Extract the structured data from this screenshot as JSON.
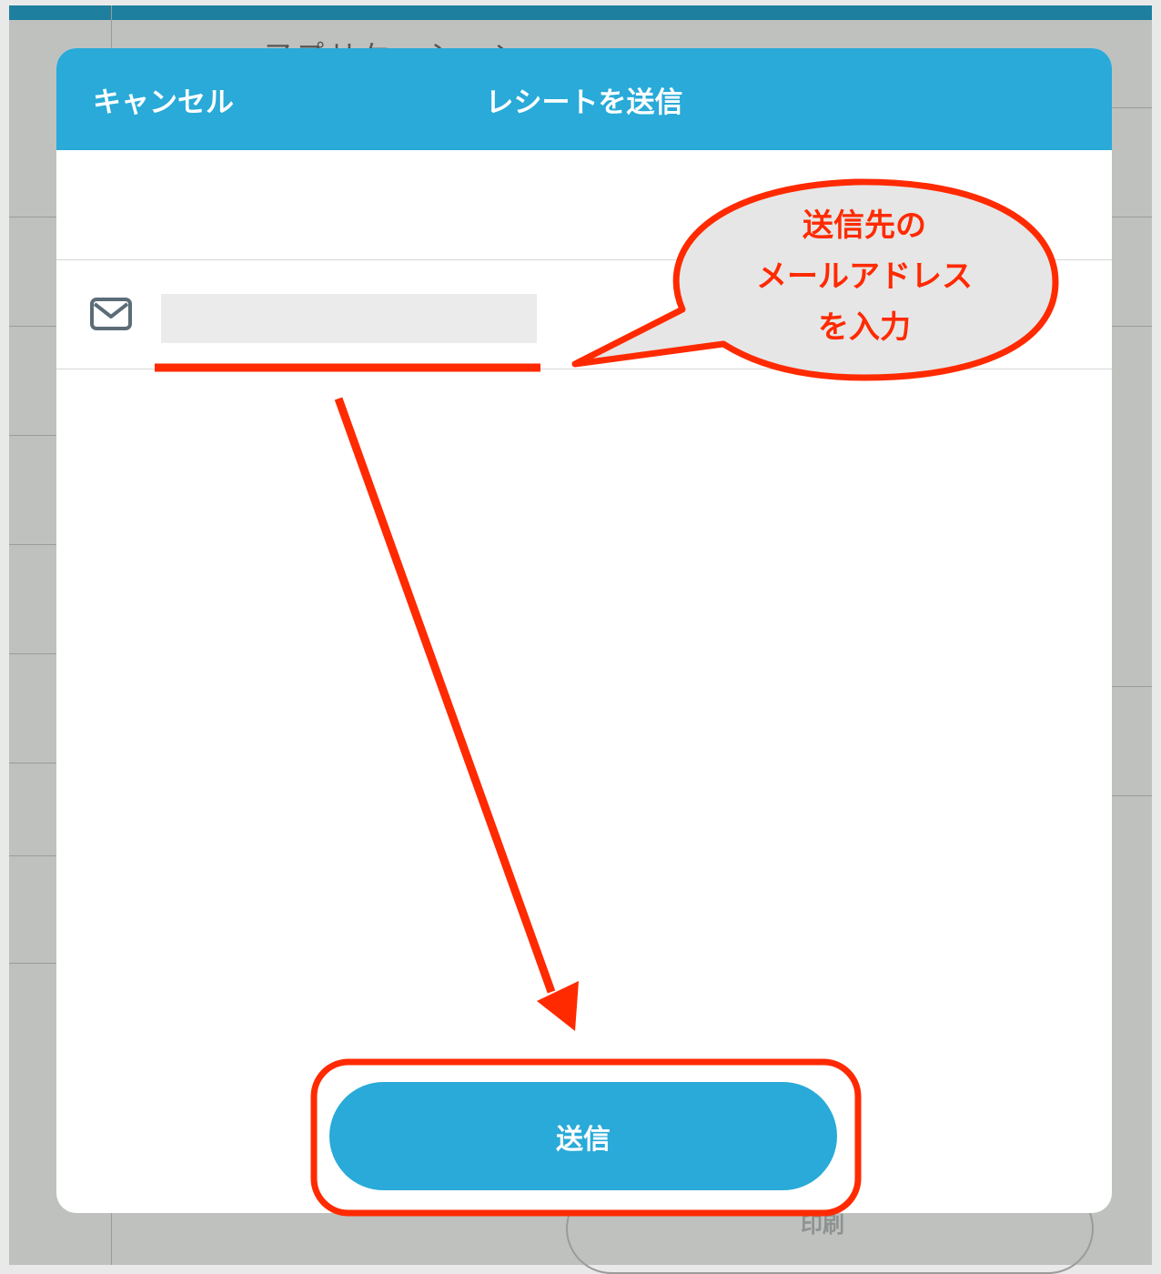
{
  "background": {
    "app_title": "アプリケーション",
    "print_label": "印刷"
  },
  "modal": {
    "header_color": "#29aad8",
    "cancel_label": "キャンセル",
    "title": "レシートを送信",
    "email": {
      "icon": "mail-icon",
      "value": "",
      "placeholder": ""
    },
    "send_label": "送信"
  },
  "annotation": {
    "color": "#ff2a00",
    "callout_lines": [
      "送信先の",
      "メールアドレス",
      "を入力"
    ]
  }
}
